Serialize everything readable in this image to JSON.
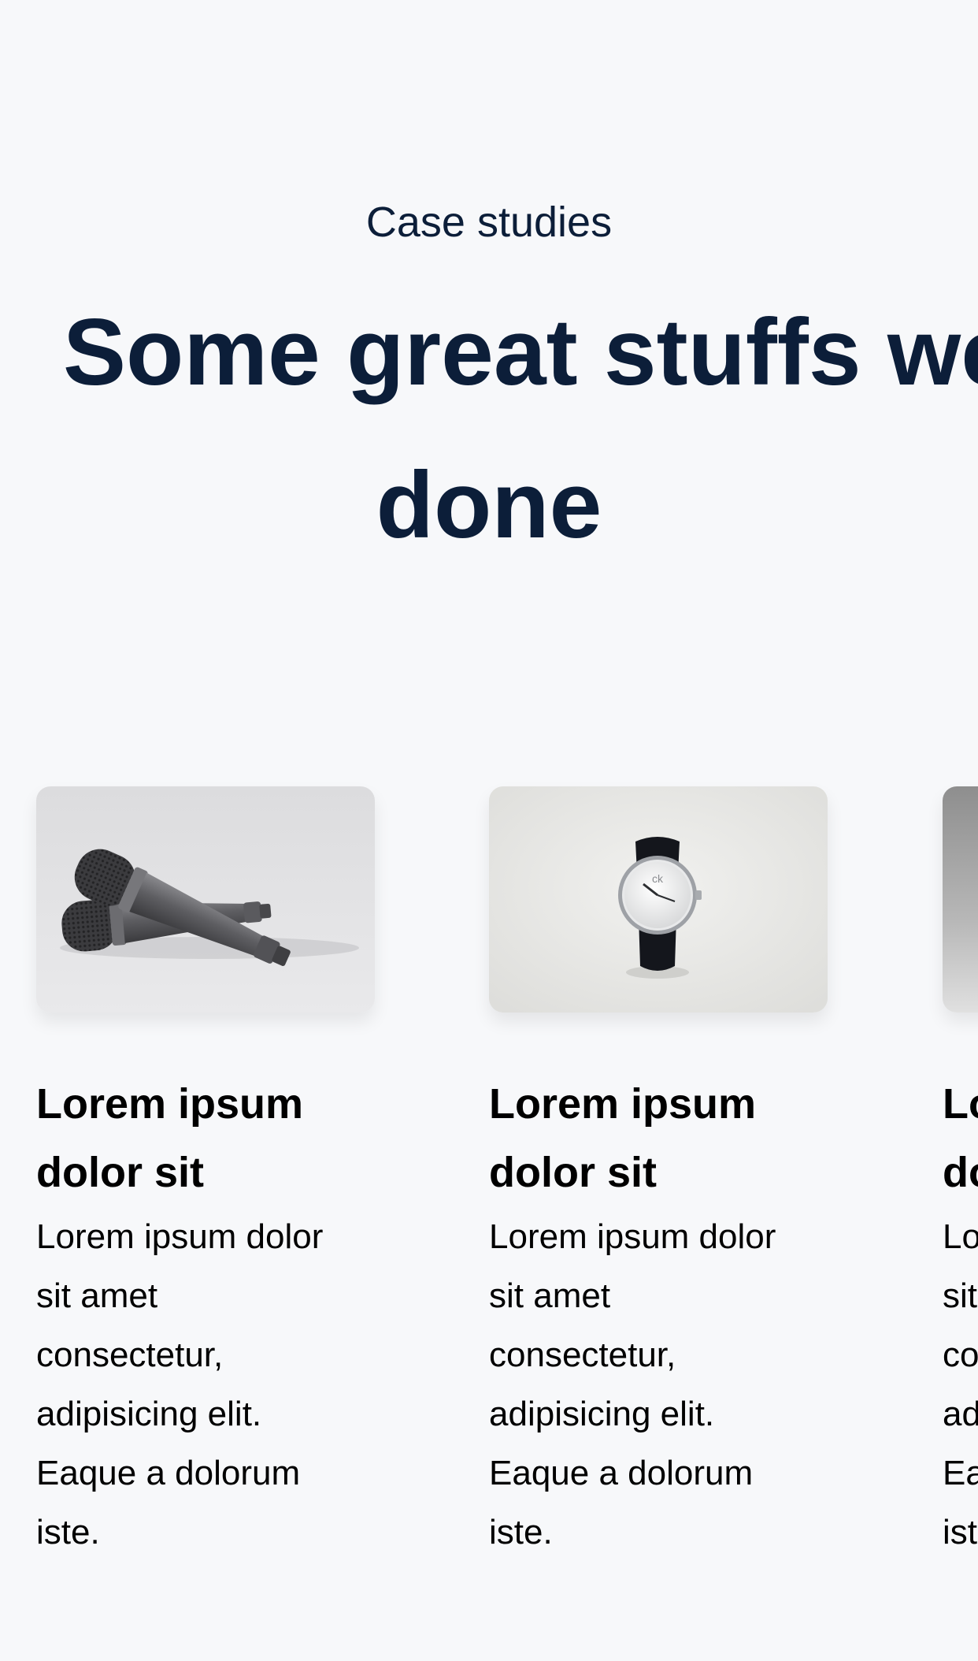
{
  "section": {
    "eyebrow": "Case studies",
    "heading_line1": "Some great stuffs we've",
    "heading_line2": "done"
  },
  "cards": [
    {
      "image": "microphones-image",
      "title_line1": "Lorem ipsum",
      "title_line2": "dolor sit",
      "text_lines": [
        "Lorem ipsum dolor",
        "sit amet",
        "consectetur,",
        "adipisicing elit.",
        "Eaque a dolorum",
        "iste."
      ]
    },
    {
      "image": "wristwatch-image",
      "title_line1": "Lorem ipsum",
      "title_line2": "dolor sit",
      "text_lines": [
        "Lorem ipsum dolor",
        "sit amet",
        "consectetur,",
        "adipisicing elit.",
        "Eaque a dolorum",
        "iste."
      ]
    },
    {
      "image": "product-image",
      "title_line1": "Lorem ipsum",
      "title_line2": "dolor sit",
      "text_lines": [
        "Lorem ipsum dolor",
        "sit amet",
        "consectetur,",
        "adipisicing elit.",
        "Eaque a dolorum",
        "iste."
      ]
    }
  ],
  "colors": {
    "background": "#f7f8fa",
    "heading": "#0c1e39",
    "text": "#000000"
  }
}
